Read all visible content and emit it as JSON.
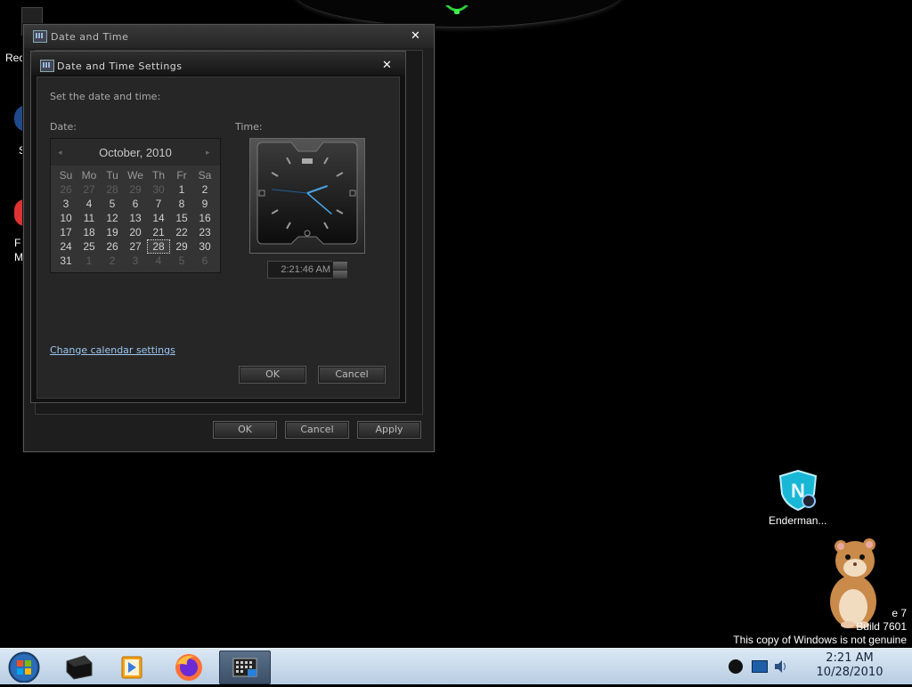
{
  "desktop": {
    "partial_labels": [
      "Rec",
      "S",
      "F",
      "M"
    ],
    "shortcut_label": "Enderman...",
    "watermark": {
      "line1": "e 7",
      "line2": "Build 7601",
      "line3": "This copy of Windows is not genuine"
    }
  },
  "outer_window": {
    "title": "Date and Time",
    "close": "✕",
    "buttons": {
      "ok": "OK",
      "cancel": "Cancel",
      "apply": "Apply"
    }
  },
  "dialog": {
    "title": "Date and Time Settings",
    "close": "✕",
    "instruction": "Set the date and time:",
    "date_label": "Date:",
    "time_label": "Time:",
    "time_value": "2:21:46 AM",
    "change_calendar_link": "Change calendar settings",
    "buttons": {
      "ok": "OK",
      "cancel": "Cancel"
    }
  },
  "calendar": {
    "month_title": "October, 2010",
    "prev": "◂",
    "next": "▸",
    "day_headers": [
      "Su",
      "Mo",
      "Tu",
      "We",
      "Th",
      "Fr",
      "Sa"
    ],
    "weeks": [
      [
        {
          "d": "26",
          "dim": true
        },
        {
          "d": "27",
          "dim": true
        },
        {
          "d": "28",
          "dim": true
        },
        {
          "d": "29",
          "dim": true
        },
        {
          "d": "30",
          "dim": true
        },
        {
          "d": "1"
        },
        {
          "d": "2"
        }
      ],
      [
        {
          "d": "3"
        },
        {
          "d": "4"
        },
        {
          "d": "5"
        },
        {
          "d": "6"
        },
        {
          "d": "7"
        },
        {
          "d": "8"
        },
        {
          "d": "9"
        }
      ],
      [
        {
          "d": "10"
        },
        {
          "d": "11"
        },
        {
          "d": "12"
        },
        {
          "d": "13"
        },
        {
          "d": "14"
        },
        {
          "d": "15"
        },
        {
          "d": "16"
        }
      ],
      [
        {
          "d": "17"
        },
        {
          "d": "18"
        },
        {
          "d": "19"
        },
        {
          "d": "20"
        },
        {
          "d": "21"
        },
        {
          "d": "22"
        },
        {
          "d": "23"
        }
      ],
      [
        {
          "d": "24"
        },
        {
          "d": "25"
        },
        {
          "d": "26"
        },
        {
          "d": "27"
        },
        {
          "d": "28",
          "selected": true
        },
        {
          "d": "29"
        },
        {
          "d": "30"
        }
      ],
      [
        {
          "d": "31"
        },
        {
          "d": "1",
          "dim": true
        },
        {
          "d": "2",
          "dim": true
        },
        {
          "d": "3",
          "dim": true
        },
        {
          "d": "4",
          "dim": true
        },
        {
          "d": "5",
          "dim": true
        },
        {
          "d": "6",
          "dim": true
        }
      ]
    ]
  },
  "clock": {
    "hours": 2,
    "minutes": 21,
    "seconds": 46
  },
  "taskbar": {
    "items": [
      {
        "name": "start-orb",
        "icon": "windows-logo-icon"
      },
      {
        "name": "taskbar-app-1",
        "icon": "black-box-icon"
      },
      {
        "name": "taskbar-media-player",
        "icon": "media-player-icon"
      },
      {
        "name": "taskbar-firefox",
        "icon": "firefox-icon"
      },
      {
        "name": "taskbar-date-time",
        "icon": "calendar-icon",
        "active": true
      }
    ],
    "tray": {
      "time": "2:21 AM",
      "date": "10/28/2010"
    }
  },
  "colors": {
    "link": "#9cc6f0",
    "taskbar_top": "#dbe8f4",
    "clock_hand_accent": "#4aa6e8"
  }
}
